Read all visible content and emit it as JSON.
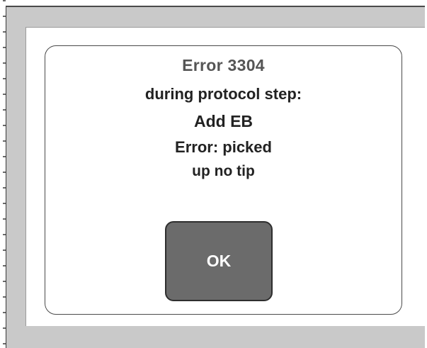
{
  "dialog": {
    "title": "Error 3304",
    "line1": "during protocol step:",
    "line2": "Add EB",
    "line3": "Error: picked",
    "line4": "up no tip",
    "ok_label": "OK"
  },
  "colors": {
    "frame": "#c9c9c9",
    "button": "#6b6b6b",
    "button_text": "#ffffff"
  }
}
